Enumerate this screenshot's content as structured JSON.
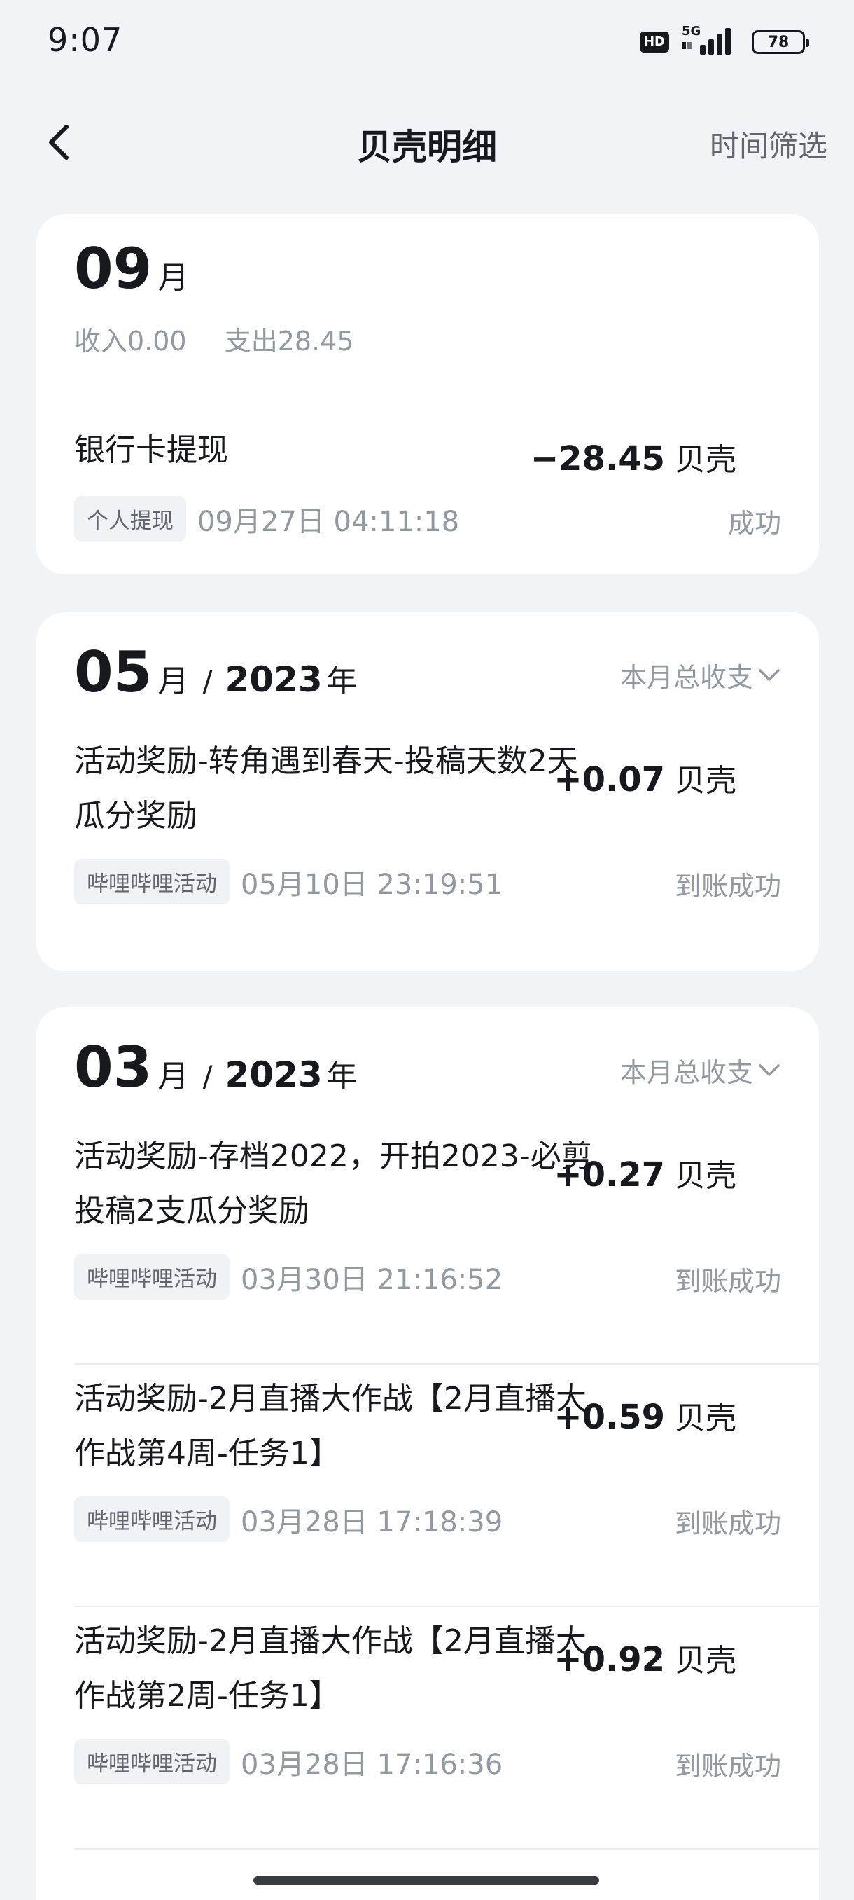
{
  "status_bar": {
    "time": "9:07",
    "hd": "HD",
    "network": "5G",
    "battery": "78"
  },
  "nav": {
    "title": "贝壳明细",
    "action": "时间筛选"
  },
  "months": [
    {
      "month": "09",
      "month_unit": "月",
      "income": "收入0.00",
      "expense": "支出28.45",
      "records": [
        {
          "title": "银行卡提现",
          "amount": "−28.45",
          "unit": "贝壳",
          "tag": "个人提现",
          "time": "09月27日 04:11:18",
          "status": "成功"
        }
      ]
    },
    {
      "month": "05",
      "month_unit": "月",
      "separator": "/",
      "year": "2023",
      "year_unit": "年",
      "toggle": "本月总收支",
      "records": [
        {
          "title": "活动奖励-转角遇到春天-投稿天数2天瓜分奖励",
          "amount": "+0.07",
          "unit": "贝壳",
          "tag": "哔哩哔哩活动",
          "time": "05月10日 23:19:51",
          "status": "到账成功"
        }
      ]
    },
    {
      "month": "03",
      "month_unit": "月",
      "separator": "/",
      "year": "2023",
      "year_unit": "年",
      "toggle": "本月总收支",
      "records": [
        {
          "title": "活动奖励-存档2022，开拍2023-必剪投稿2支瓜分奖励",
          "amount": "+0.27",
          "unit": "贝壳",
          "tag": "哔哩哔哩活动",
          "time": "03月30日 21:16:52",
          "status": "到账成功"
        },
        {
          "title": "活动奖励-2月直播大作战【2月直播大作战第4周-任务1】",
          "amount": "+0.59",
          "unit": "贝壳",
          "tag": "哔哩哔哩活动",
          "time": "03月28日 17:18:39",
          "status": "到账成功"
        },
        {
          "title": "活动奖励-2月直播大作战【2月直播大作战第2周-任务1】",
          "amount": "+0.92",
          "unit": "贝壳",
          "tag": "哔哩哔哩活动",
          "time": "03月28日 17:16:36",
          "status": "到账成功"
        }
      ]
    }
  ]
}
